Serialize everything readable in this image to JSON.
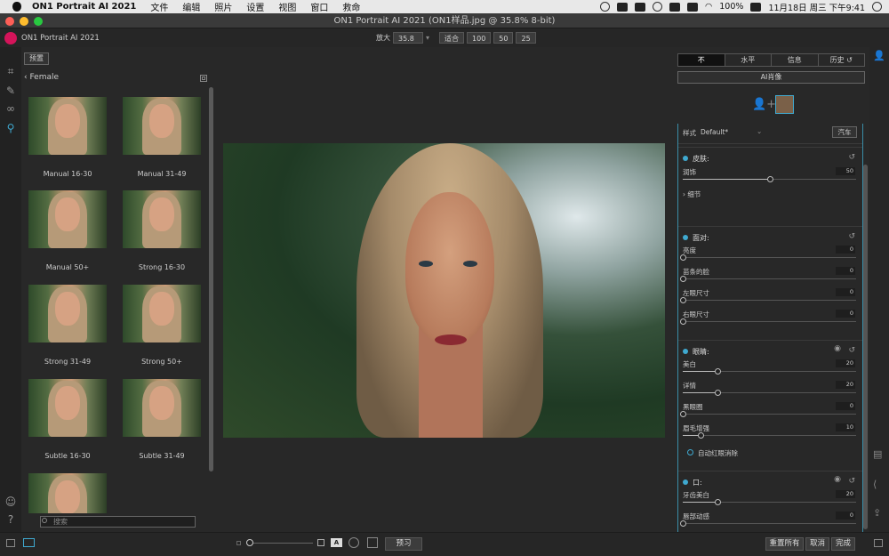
{
  "menubar": {
    "app": "ON1 Portrait AI 2021",
    "items": [
      "文件",
      "编辑",
      "照片",
      "设置",
      "视图",
      "窗口",
      "救命"
    ],
    "battery": "100%",
    "datetime": "11月18日 周三 下午9:41"
  },
  "window": {
    "title": "ON1 Portrait AI 2021 (ON1样品.jpg @ 35.8% 8-bit)"
  },
  "appbar": {
    "name": "ON1 Portrait AI 2021",
    "zoom_label": "放大",
    "zoom_value": "35.8",
    "fit": "适合",
    "z100": "100",
    "z50": "50",
    "z25": "25"
  },
  "left": {
    "preset_btn": "预置",
    "back_label": "Female",
    "search_placeholder": "搜索",
    "presets": [
      "Manual 16-30",
      "Manual 31-49",
      "Manual 50+",
      "Strong 16-30",
      "Strong 31-49",
      "Strong 50+",
      "Subtle 16-30",
      "Subtle 31-49"
    ]
  },
  "right": {
    "tabs": [
      "不",
      "水平",
      "信息",
      "历史"
    ],
    "ai_btn": "AI肖像",
    "style_label": "样式",
    "style_value": "Default*",
    "car_btn": "汽车",
    "skin": {
      "title": "皮肤:",
      "slider": "润饰",
      "value": "50",
      "detail": "细节"
    },
    "face": {
      "title": "面对:",
      "sliders": [
        {
          "label": "亮度",
          "value": "0"
        },
        {
          "label": "苗条的脸",
          "value": "0"
        },
        {
          "label": "左眼尺寸",
          "value": "0"
        },
        {
          "label": "右眼尺寸",
          "value": "0"
        }
      ]
    },
    "eyes": {
      "title": "眼睛:",
      "sliders": [
        {
          "label": "美白",
          "value": "20"
        },
        {
          "label": "详情",
          "value": "20"
        },
        {
          "label": "黑眼圈",
          "value": "0"
        },
        {
          "label": "眉毛增强",
          "value": "10"
        }
      ],
      "redeye": "自动红眼消除"
    },
    "mouth": {
      "title": "口:",
      "sliders": [
        {
          "label": "牙齿美白",
          "value": "20"
        },
        {
          "label": "唇部动感",
          "value": "0"
        }
      ]
    }
  },
  "bottom": {
    "preview": "预习",
    "reset_all": "重置所有",
    "cancel": "取消",
    "done": "完成"
  },
  "colors": {
    "accent": "#3fa9d0",
    "logo": "#d4145a"
  }
}
